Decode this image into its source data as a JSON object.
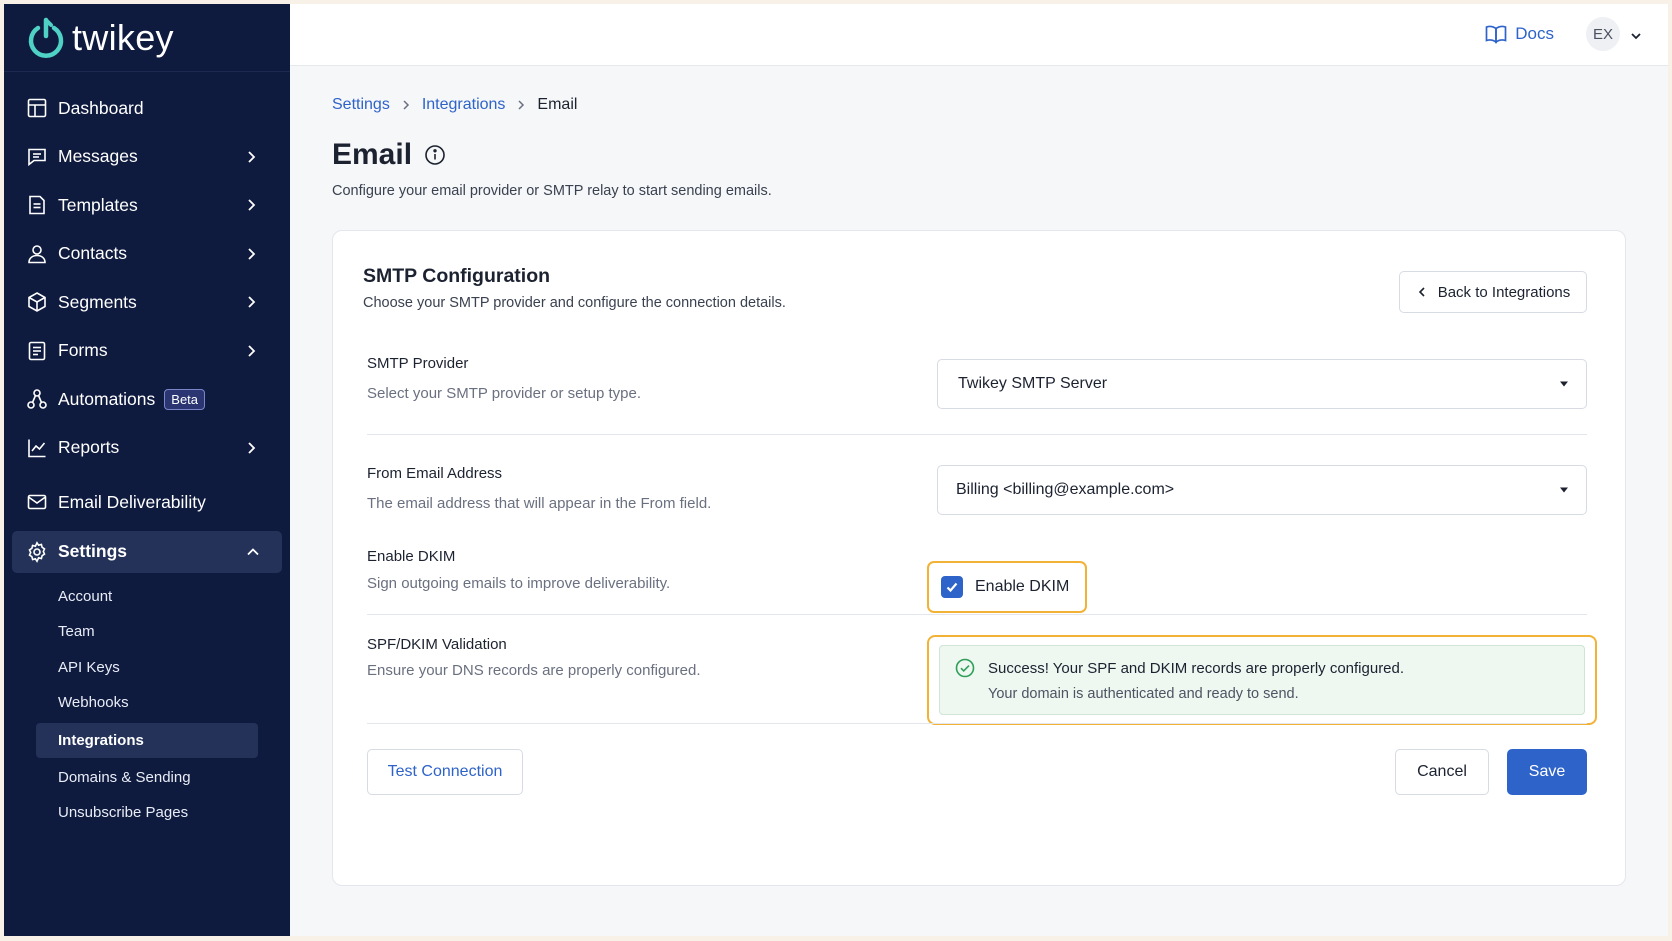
{
  "brand": {
    "name": "twikey",
    "accent": "#2e63c9",
    "sidebar_bg": "#0e1a3e",
    "logo_color": "#4fd1c5"
  },
  "sidebar": {
    "items": [
      {
        "label": "Dashboard",
        "icon": "dashboard-icon",
        "chevron": false
      },
      {
        "label": "Messages",
        "icon": "message-icon",
        "chevron": true
      },
      {
        "label": "Templates",
        "icon": "template-icon",
        "chevron": true
      },
      {
        "label": "Contacts",
        "icon": "user-icon",
        "chevron": true
      },
      {
        "label": "Segments",
        "icon": "cube-icon",
        "chevron": true
      },
      {
        "label": "Forms",
        "icon": "form-icon",
        "chevron": true
      },
      {
        "label": "Automations",
        "icon": "automation-icon",
        "badge": "Beta"
      },
      {
        "label": "Reports",
        "icon": "chart-icon",
        "chevron": true
      },
      {
        "label": "Email Deliverability",
        "icon": "mail-icon"
      }
    ],
    "settings": {
      "label": "Settings",
      "icon": "gear-icon",
      "expanded": true,
      "sub_items": [
        "Account",
        "Team",
        "API Keys",
        "Webhooks",
        "Integrations",
        "Domains & Sending",
        "Unsubscribe Pages"
      ],
      "active": "Integrations"
    }
  },
  "topbar": {
    "docs_label": "Docs",
    "avatar_initials": "EX"
  },
  "breadcrumb": [
    "Settings",
    "Integrations",
    "Email"
  ],
  "page": {
    "title": "Email",
    "subtitle": "Configure your email provider or SMTP relay to start sending emails."
  },
  "card": {
    "title": "SMTP Configuration",
    "subtitle": "Choose your SMTP provider and configure the connection details.",
    "back_button": "Back to Integrations",
    "smtp_provider": {
      "label": "SMTP Provider",
      "description": "Select your SMTP provider or setup type.",
      "value": "Twikey SMTP Server"
    },
    "from_email": {
      "label": "From Email Address",
      "description": "The email address that will appear in the From field.",
      "value": "Billing <billing@example.com>"
    },
    "dkim": {
      "label": "Enable DKIM",
      "description": "Sign outgoing emails to improve deliverability.",
      "checkbox_label": "Enable DKIM",
      "checked": true
    },
    "validation": {
      "label": "SPF/DKIM Validation",
      "description": "Ensure your DNS records are properly configured.",
      "success_title": "Success! Your SPF and DKIM records are properly configured.",
      "success_sub": "Your domain is authenticated and ready to send."
    },
    "buttons": {
      "test": "Test Connection",
      "cancel": "Cancel",
      "save": "Save"
    }
  }
}
